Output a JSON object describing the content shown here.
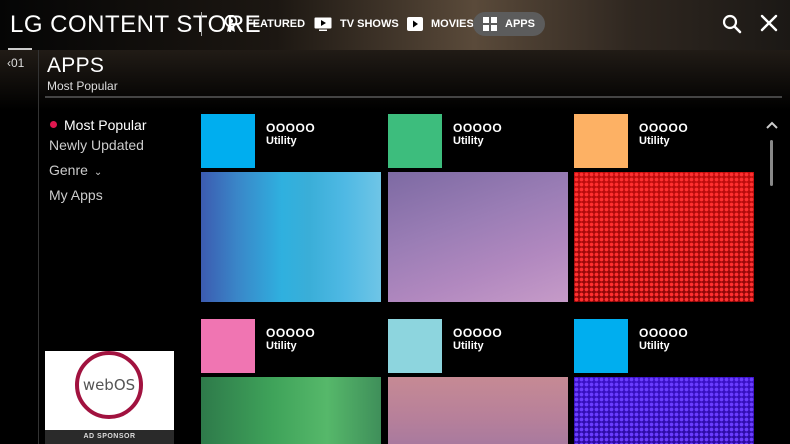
{
  "header": {
    "brand": "LG CONTENT STORE",
    "nav": [
      {
        "label": "FEATURED",
        "icon": "medal-icon"
      },
      {
        "label": "TV SHOWS",
        "icon": "tv-play-icon"
      },
      {
        "label": "MOVIES",
        "icon": "movie-play-icon"
      },
      {
        "label": "APPS",
        "icon": "apps-grid-icon",
        "selected": true
      }
    ],
    "search_icon": "search-icon",
    "close_icon": "close-icon"
  },
  "side": {
    "back_label": "‹01"
  },
  "page": {
    "title": "APPS",
    "subtitle": "Most Popular"
  },
  "menu": {
    "items": [
      "Most Popular",
      "Newly Updated",
      "Genre",
      "My Apps"
    ],
    "active": "Most Popular",
    "accent": "#e0174f"
  },
  "apps": [
    {
      "name": "OOOOO",
      "category": "Utility",
      "icon_color": "#00aeef"
    },
    {
      "name": "OOOOO",
      "category": "Utility",
      "icon_color": "#3dbd7d"
    },
    {
      "name": "OOOOO",
      "category": "Utility",
      "icon_color": "#fdb164"
    },
    {
      "name": "OOOOO",
      "category": "Utility",
      "icon_color": "#f075b2"
    },
    {
      "name": "OOOOO",
      "category": "Utility",
      "icon_color": "#8dd5de"
    },
    {
      "name": "OOOOO",
      "category": "Utility",
      "icon_color": "#00aeef"
    }
  ],
  "ad": {
    "logo_text": "webOS",
    "label": "AD SPONSOR"
  }
}
